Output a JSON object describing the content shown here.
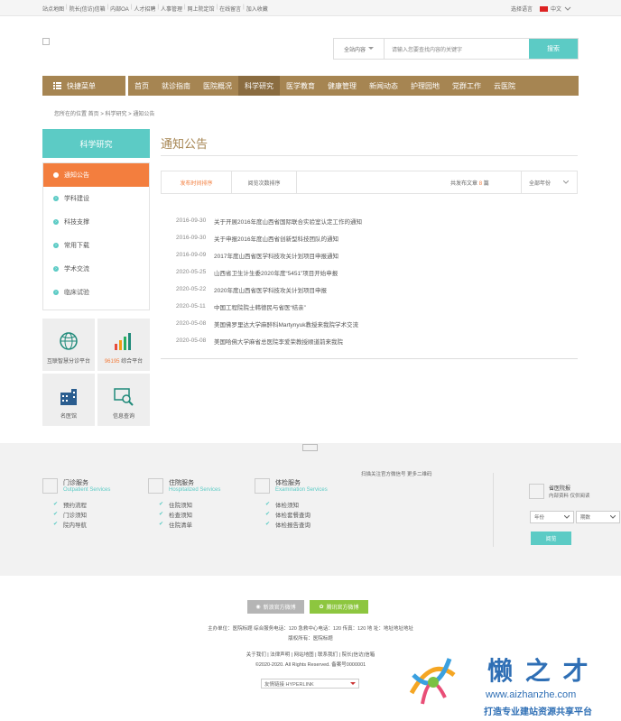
{
  "topbar": {
    "links": [
      "站点地图",
      "院长(信访)信箱",
      "内部OA",
      "人才招聘",
      "人事管理",
      "网上院定馆",
      "在线留言",
      "加入收藏"
    ],
    "lang_label": "选择语言",
    "lang_value": "中文"
  },
  "search": {
    "scope": "全站内容",
    "placeholder": "请输入您要查找内容的关键字",
    "button": "搜索"
  },
  "nav": {
    "quick_menu": "快捷菜单",
    "items": [
      "首页",
      "就诊指南",
      "医院概况",
      "科学研究",
      "医学教育",
      "健康管理",
      "新闻动态",
      "护理园地",
      "党群工作",
      "云医院"
    ],
    "active_index": 3
  },
  "breadcrumb": "您所在的位置  首页 > 科学研究 > 通知公告",
  "sidebar": {
    "title": "科学研究",
    "items": [
      "通知公告",
      "学科建设",
      "科技支撑",
      "常用下载",
      "学术交流",
      "临床试验"
    ],
    "active_index": 0,
    "tiles": [
      {
        "label": "互联智慧分诊平台",
        "icon": "globe-icon"
      },
      {
        "label_hot": "96195",
        "label": " 综合平台",
        "icon": "bar-chart-icon"
      },
      {
        "label": "名医馆",
        "icon": "building-icon"
      },
      {
        "label": "信息查询",
        "icon": "search-screen-icon"
      }
    ]
  },
  "main": {
    "title": "通知公告",
    "sort_publish": "发布时间排序",
    "sort_views": "阅览次数排序",
    "count_prefix": "共发布文章",
    "count": "8",
    "count_suffix": "篇",
    "year_filter": "全部年份",
    "news": [
      {
        "date": "2016-09-30",
        "title": "关于开展2016年度山西省国际联合实验室认定工作的通知"
      },
      {
        "date": "2016-09-30",
        "title": "关于申报2016年度山西省创新型科技团队的通知"
      },
      {
        "date": "2016-09-09",
        "title": "2017年度山西省医学科技攻关计划项目申报通知"
      },
      {
        "date": "2020-05-25",
        "title": "山西省卫生计生委2020年度“5451”项目开始申报"
      },
      {
        "date": "2020-05-22",
        "title": "2020年度山西省医学科技攻关计划项目申报"
      },
      {
        "date": "2020-05-11",
        "title": "中国工程院院士韩德民与省医“结亲”"
      },
      {
        "date": "2020-05-08",
        "title": "美国佛罗里达大学麻醉科Martynyuk教授来我院学术交流"
      },
      {
        "date": "2020-05-08",
        "title": "美国哈佛大学麻省总医院李爱荣教授顺道前来我院"
      }
    ]
  },
  "footer": {
    "scan_text": "扫描关注官方微信号 更多二维码",
    "columns": [
      {
        "title": "门诊服务",
        "subtitle": "Outpatient Services",
        "items": [
          "预约流程",
          "门诊须知",
          "院内导航"
        ]
      },
      {
        "title": "住院服务",
        "subtitle": "Hospitalized Services",
        "items": [
          "住院须知",
          "检查须知",
          "住院清单"
        ]
      },
      {
        "title": "体检服务",
        "subtitle": "Examination Services",
        "items": [
          "体检须知",
          "体检套餐查询",
          "体检报告查询"
        ]
      }
    ],
    "report_title": "省医院报",
    "report_sub": "内部资料 仅供阅读",
    "year_select": "年份",
    "issue_select": "期数",
    "read_button": "阅览",
    "weibo_sina": "新浪官方微博",
    "weibo_tencent": "腾讯官方微博",
    "info_line1": "主办单位：医院标题    综合服务电话：120    急救中心电话：120    传真：120    地 址：地址地址地址",
    "info_line2": "版权所有：医院标题",
    "links_line": "关于我们 | 法律声明 | 网站地图 | 联系我们 | 院长(信访)信箱",
    "copyright": "©2020-2020. All Rights Reserved. 备案号0000001",
    "friend_links": "友情链接 HYPERLINK",
    "watermark_brand": "懒 之 才",
    "watermark_url": "www.aizhanzhe.com",
    "watermark_slogan": "打造专业建站资源共享平台"
  },
  "colors": {
    "teal": "#5ccbc5",
    "brown": "#a68552",
    "orange": "#f37e3e"
  }
}
